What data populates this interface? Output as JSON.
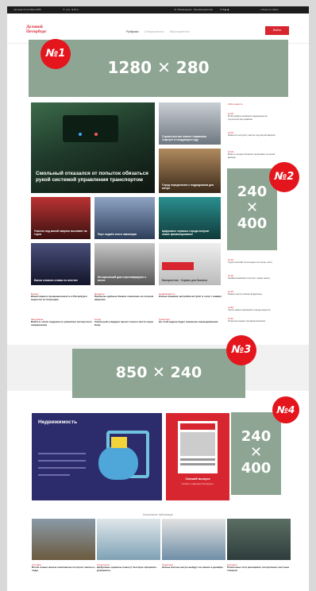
{
  "topbar": {
    "date": "пятница 13 октября 2023",
    "weather": "☀ +14 · $ 97,4",
    "links": "☏ Размещение · Рекламодателям",
    "social": "✉ ♥ ▶ ◆",
    "search": "⌕ Поиск по сайту"
  },
  "header": {
    "logo_line1": "Деловой",
    "logo_line2": "Петербург",
    "nav_active": "Рубрики",
    "nav_dim1": "Спецпроекты",
    "nav_dim2": "Мероприятия",
    "subscribe_label": "Войти"
  },
  "ads": [
    {
      "badge": "№1",
      "size": "1280 ✕ 280"
    },
    {
      "badge": "№2",
      "line1": "240",
      "line2": "✕",
      "line3": "400"
    },
    {
      "badge": "№3",
      "size": "850 ✕ 240"
    },
    {
      "badge": "№4",
      "line1": "240",
      "line2": "✕",
      "line3": "400"
    }
  ],
  "hero": {
    "caption": "Смольный отказался от попыток обязаться рукой системой управления транспортом"
  },
  "tiles": [
    {
      "caption": "Строительство нового терминала стартует в следующем году"
    },
    {
      "caption": "Город определился с подрядчиком для метро"
    },
    {
      "caption": "Участок под жилой квартал выставят на торги"
    },
    {
      "caption": "Порт подвёл итоги навигации"
    },
    {
      "caption": "Цифровые сервисы города получат новое финансирование"
    },
    {
      "caption": "Банки снизили ставки по ипотеке"
    },
    {
      "caption": "7 вопросов про деньги"
    },
    {
      "caption": "Исторический дом отреставрируют к весне"
    },
    {
      "caption": "Банкротство · Сервис для бизнеса"
    }
  ],
  "news_column": [
    {
      "time": "● Все новости",
      "headline": ""
    },
    {
      "time": "14:02",
      "headline": "В Петербурге выбрали подрядчика на строительство развязки"
    },
    {
      "time": "13:45",
      "headline": "Инвестор получил участок под жилой квартал"
    },
    {
      "time": "13:20",
      "headline": "Власти города обновили программу льготной аренды"
    },
    {
      "time": "13:01",
      "headline": "Туристический поток вырос на пятую часть"
    },
    {
      "time": "12:40",
      "headline": "На Васильевском построят новую школу"
    },
    {
      "time": "12:15",
      "headline": "Бизнес-центр сменил владельца"
    },
    {
      "time": "11:58",
      "headline": "Число новых компаний в городе выросло"
    },
    {
      "time": "11:30",
      "headline": "Открылся новый торговый комплекс"
    },
    {
      "time": "11:02",
      "headline": "Спрос на склады растёт"
    }
  ],
  "headlines": [
    {
      "category": "Бизнес",
      "headline": "Инвестиции в промышленность в Петербурге выросли за полугодие"
    },
    {
      "category": "Финансы",
      "headline": "Прибыль крупных банков снизилась во втором квартале"
    },
    {
      "category": "Недвижимость",
      "headline": "Новые правила застройки вступят в силу с января"
    },
    {
      "category": "Экономика",
      "headline": "Войти в число лидеров по развитию экспортного направления"
    },
    {
      "category": "Город",
      "headline": "Смольный утвердил проект нового моста через Неву"
    },
    {
      "category": "Транспорт",
      "headline": "На этой неделе будет изменена схема движения"
    }
  ],
  "promo": {
    "realty_title": "Недвижимость",
    "issue_label": "Свежий выпуск",
    "issue_sub": "Читайте в «Деловом Петербурге»"
  },
  "bottom": {
    "section_title": "Актуальные публикации",
    "cards": [
      {
        "category": "Стройка",
        "headline": "Возле новых жилых комплексов построят школы и сады"
      },
      {
        "category": "Технологии",
        "headline": "Цифровые сервисы помогут быстрее оформить документы"
      },
      {
        "category": "Транспорт",
        "headline": "Новые вагоны метро выйдут на линию в декабре"
      },
      {
        "category": "Торговля",
        "headline": "Розничные сети расширяют ассортимент местных товаров"
      }
    ]
  }
}
